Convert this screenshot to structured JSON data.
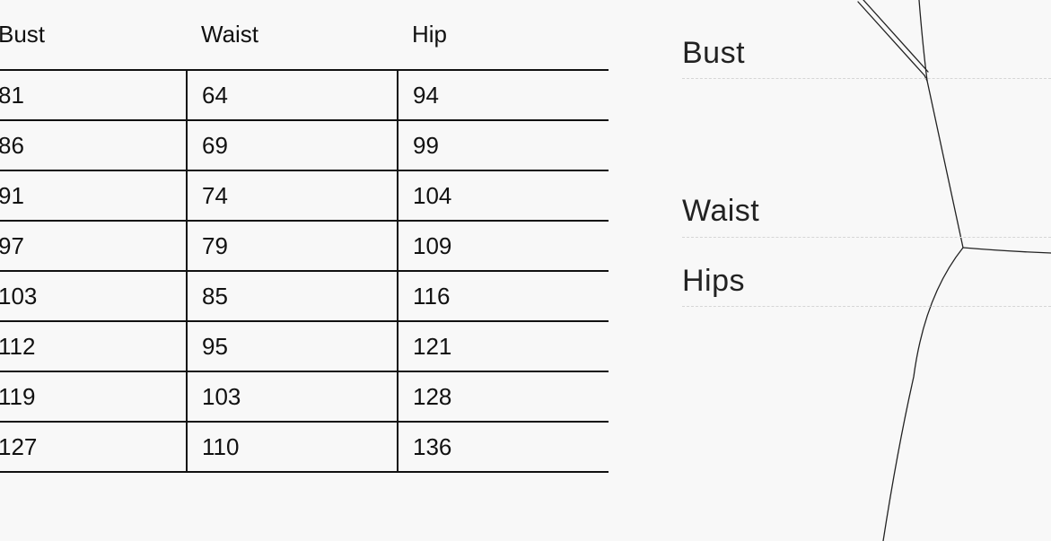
{
  "table": {
    "headers": [
      "Bust",
      "Waist",
      "Hip"
    ],
    "rows": [
      [
        "81",
        "64",
        "94"
      ],
      [
        "86",
        "69",
        "99"
      ],
      [
        "91",
        "74",
        "104"
      ],
      [
        "97",
        "79",
        "109"
      ],
      [
        "103",
        "85",
        "116"
      ],
      [
        "112",
        "95",
        "121"
      ],
      [
        "119",
        "103",
        "128"
      ],
      [
        "127",
        "110",
        "136"
      ]
    ]
  },
  "guide": {
    "bust_label": "Bust",
    "waist_label": "Waist",
    "hips_label": "Hips"
  }
}
